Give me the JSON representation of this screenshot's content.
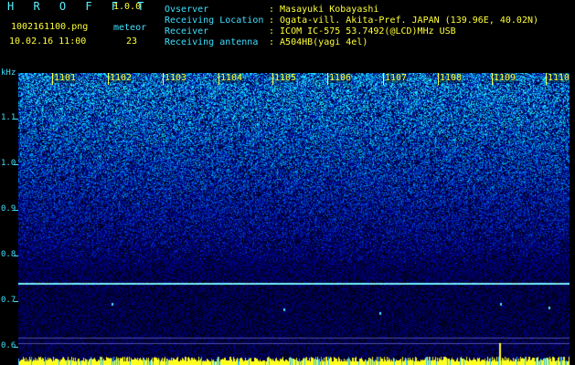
{
  "app": {
    "title": "H R O F F T",
    "version": "1.0.0"
  },
  "info": {
    "file": "1002161100.png",
    "datetime": "10.02.16 11:00",
    "meteor_label": "meteor",
    "meteor_count": "23"
  },
  "observer": {
    "labels": [
      "Ovserver",
      "Receiving Location",
      "Receiver",
      "Receiving antenna"
    ],
    "values": [
      ": Masayuki Kobayashi",
      ": Ogata-vill. Akita-Pref. JAPAN (139.96E, 40.02N)",
      ": ICOM IC-575 53.7492(@LCD)MHz USB",
      ": A504HB(yagi 4el)"
    ]
  },
  "axis": {
    "unit": "kHz",
    "y_ticks": [
      "1.1",
      "1.0",
      "0.9",
      "0.8",
      "0.7",
      "0.6"
    ],
    "x_ticks": [
      "1101",
      "1102",
      "1103",
      "1104",
      "1105",
      "1106",
      "1107",
      "1108",
      "1109",
      "1110"
    ]
  },
  "colors": {
    "header_text": "#3fe0ff",
    "accent": "#ffff3a",
    "background": "#000000"
  }
}
